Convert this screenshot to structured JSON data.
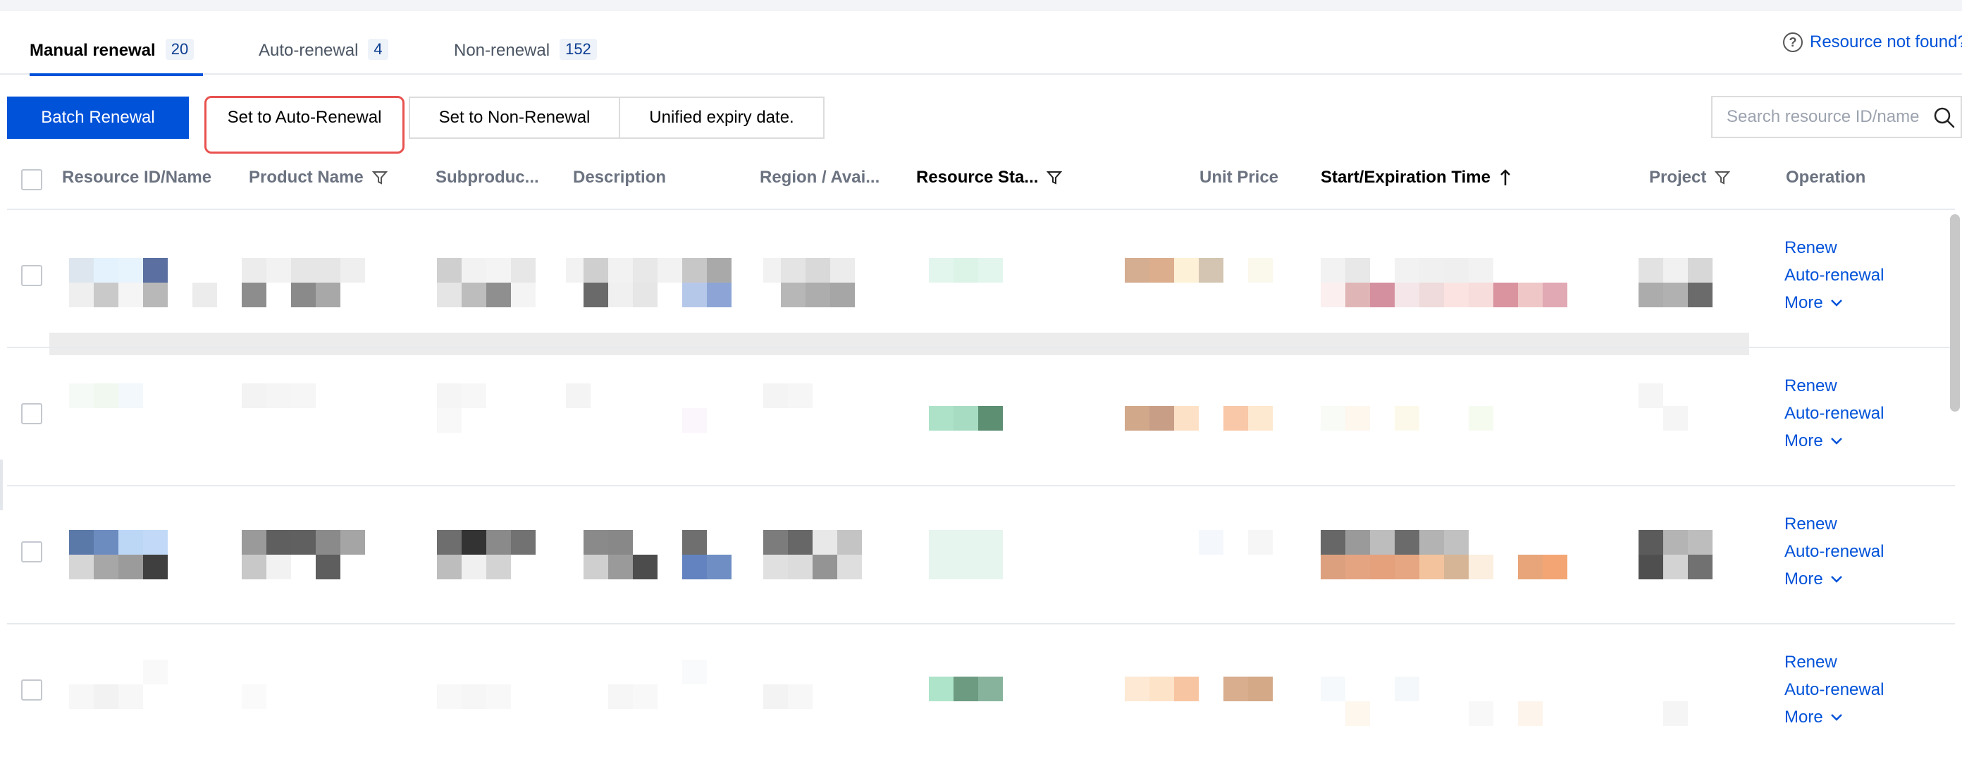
{
  "tabs": [
    {
      "label": "Manual renewal",
      "count": "20"
    },
    {
      "label": "Auto-renewal",
      "count": "4"
    },
    {
      "label": "Non-renewal",
      "count": "152"
    }
  ],
  "help_link": "Resource not found?",
  "toolbar": {
    "batch_renewal": "Batch Renewal",
    "set_auto": "Set to Auto-Renewal",
    "set_non": "Set to Non-Renewal",
    "unified": "Unified expiry date."
  },
  "search": {
    "placeholder": "Search resource ID/name"
  },
  "columns": {
    "resource_id": "Resource ID/Name",
    "product_name": "Product Name",
    "subproduct": "Subproduc...",
    "description": "Description",
    "region": "Region / Avai...",
    "resource_status": "Resource Sta...",
    "unit_price": "Unit Price",
    "start_expiration": "Start/Expiration Time",
    "project": "Project",
    "operation": "Operation"
  },
  "row_ops": {
    "renew": "Renew",
    "auto_renewal": "Auto-renewal",
    "more": "More"
  },
  "colors": {
    "accent": "#0052d9",
    "highlight": "#e8524f"
  }
}
